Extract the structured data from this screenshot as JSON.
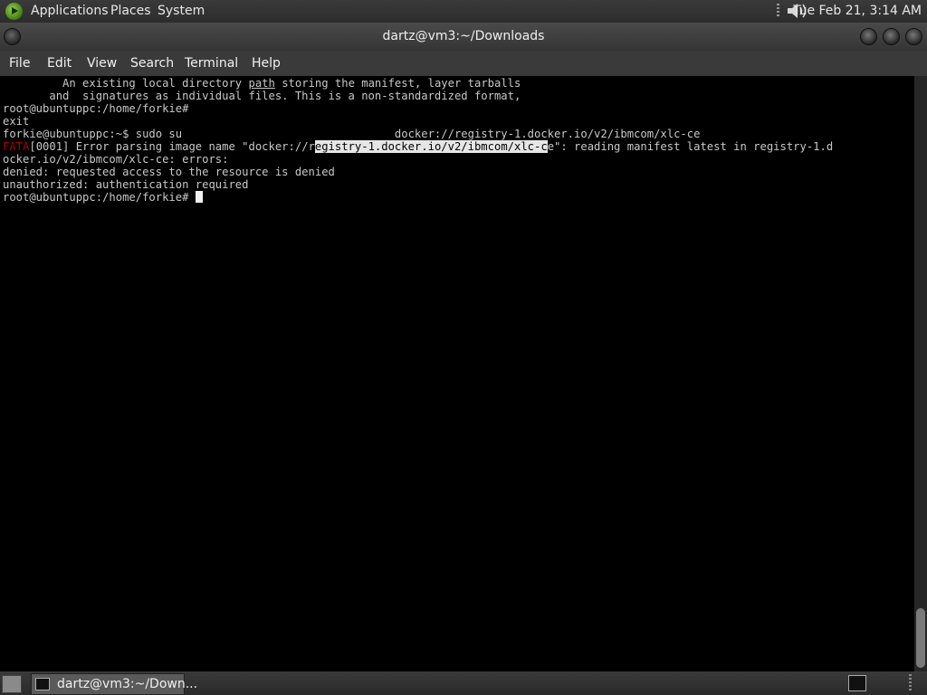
{
  "top_panel": {
    "menus": [
      "Applications",
      "Places",
      "System"
    ],
    "clock": "Tue Feb 21,  3:14 AM"
  },
  "window": {
    "title": "dartz@vm3:~/Downloads"
  },
  "menubar": [
    "File",
    "Edit",
    "View",
    "Search",
    "Terminal",
    "Help"
  ],
  "terminal": {
    "l1_pre": "         An existing local directory ",
    "l1_u": "path",
    "l1_post": " storing the manifest, layer tarballs",
    "l2": "       and  signatures as individual files. This is a non-standardized format,",
    "l3": "root@ubuntuppc:/home/forkie#",
    "l4": "exit",
    "l5": "forkie@ubuntuppc:~$ sudo su                                docker://registry-1.docker.io/v2/ibmcom/xlc-ce",
    "l6_fatal": "FATA",
    "l6_a": "[0001] Error parsing image name \"docker://r",
    "l6_sel": "egistry-1.docker.io/v2/ibmcom/xlc-c",
    "l6_b": "e\": reading manifest latest in registry-1.d",
    "l7": "ocker.io/v2/ibmcom/xlc-ce: errors:",
    "l8": "denied: requested access to the resource is denied",
    "l9": "unauthorized: authentication required",
    "l10": "root@ubuntuppc:/home/forkie# "
  },
  "taskbar": {
    "task_label": "dartz@vm3:~/Down..."
  },
  "icons": {
    "apps": "gnome-foot-icon",
    "volume": "speaker-icon",
    "show_desktop": "show-desktop-icon",
    "terminal": "terminal-icon"
  }
}
